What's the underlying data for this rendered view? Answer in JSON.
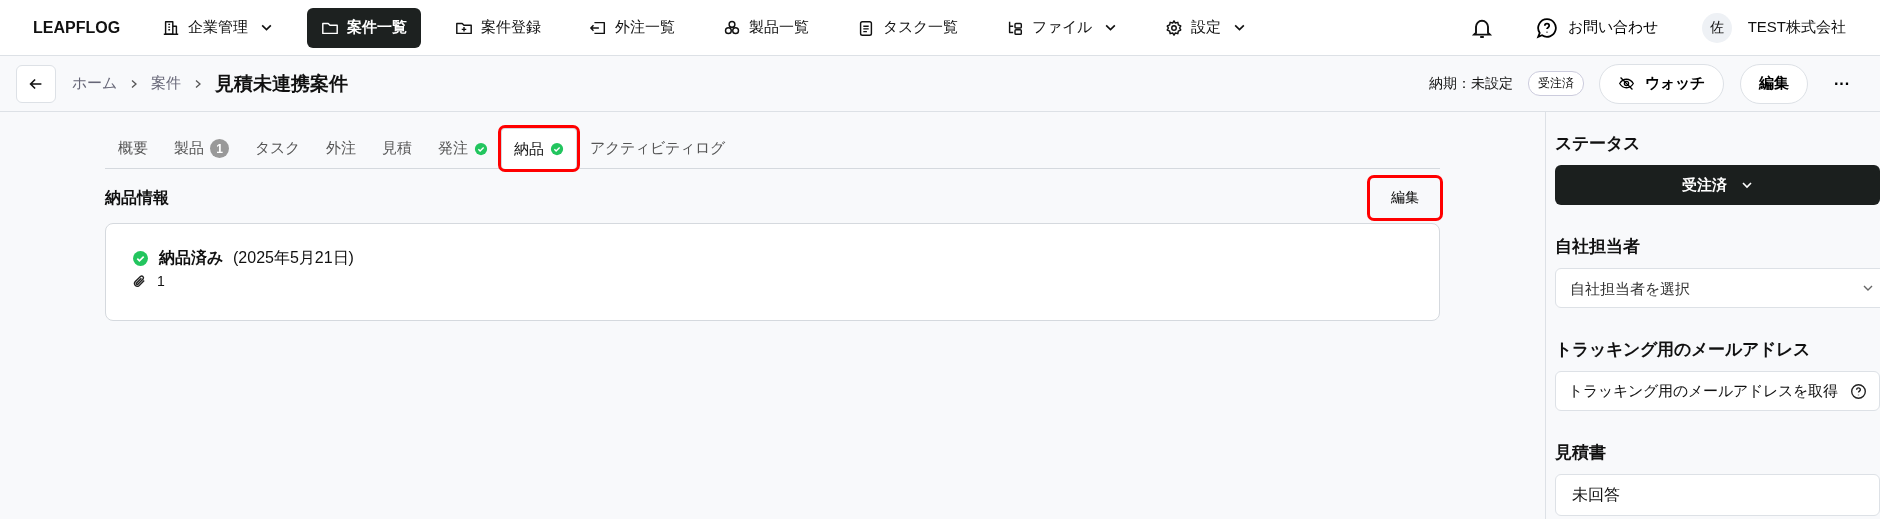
{
  "logo": "LEAPFLOG",
  "nav": [
    {
      "label": "企業管理",
      "caret": true,
      "selected": false
    },
    {
      "label": "案件一覧",
      "caret": false,
      "selected": true
    },
    {
      "label": "案件登録",
      "caret": false,
      "selected": false
    },
    {
      "label": "外注一覧",
      "caret": false,
      "selected": false
    },
    {
      "label": "製品一覧",
      "caret": false,
      "selected": false
    },
    {
      "label": "タスク一覧",
      "caret": false,
      "selected": false
    },
    {
      "label": "ファイル",
      "caret": true,
      "selected": false
    },
    {
      "label": "設定",
      "caret": true,
      "selected": false
    }
  ],
  "header_right": {
    "contact": "お問い合わせ",
    "avatar": "佐",
    "company": "TEST株式会社"
  },
  "breadcrumb": [
    "ホーム",
    "案件"
  ],
  "page_title": "見積未連携案件",
  "deadline": "納期：未設定",
  "status_badge": "受注済",
  "watch_button": "ウォッチ",
  "edit_button": "編集",
  "more_button": "···",
  "tabs": [
    {
      "label": "概要",
      "selected": false,
      "done": false,
      "highlighted": false
    },
    {
      "label": "製品",
      "selected": false,
      "badge": "1",
      "done": false,
      "highlighted": false
    },
    {
      "label": "タスク",
      "selected": false,
      "done": false,
      "highlighted": false
    },
    {
      "label": "外注",
      "selected": false,
      "done": false,
      "highlighted": false
    },
    {
      "label": "見積",
      "selected": false,
      "done": false,
      "highlighted": false
    },
    {
      "label": "発注",
      "selected": false,
      "done": true,
      "highlighted": false
    },
    {
      "label": "納品",
      "selected": true,
      "done": true,
      "highlighted": true
    },
    {
      "label": "アクティビティログ",
      "selected": false,
      "done": false,
      "highlighted": false
    }
  ],
  "section": {
    "title": "納品情報",
    "edit_button": "編集",
    "edit_highlighted": true,
    "status": "納品済み",
    "date": "(2025年5月21日)",
    "attachments": "1"
  },
  "sidebar": {
    "status_label": "ステータス",
    "status_value": "受注済",
    "assignee_label": "自社担当者",
    "assignee_placeholder": "自社担当者を選択",
    "tracking_label": "トラッキング用のメールアドレス",
    "tracking_button": "トラッキング用のメールアドレスを取得",
    "quote_label": "見積書",
    "quote_value": "未回答"
  }
}
